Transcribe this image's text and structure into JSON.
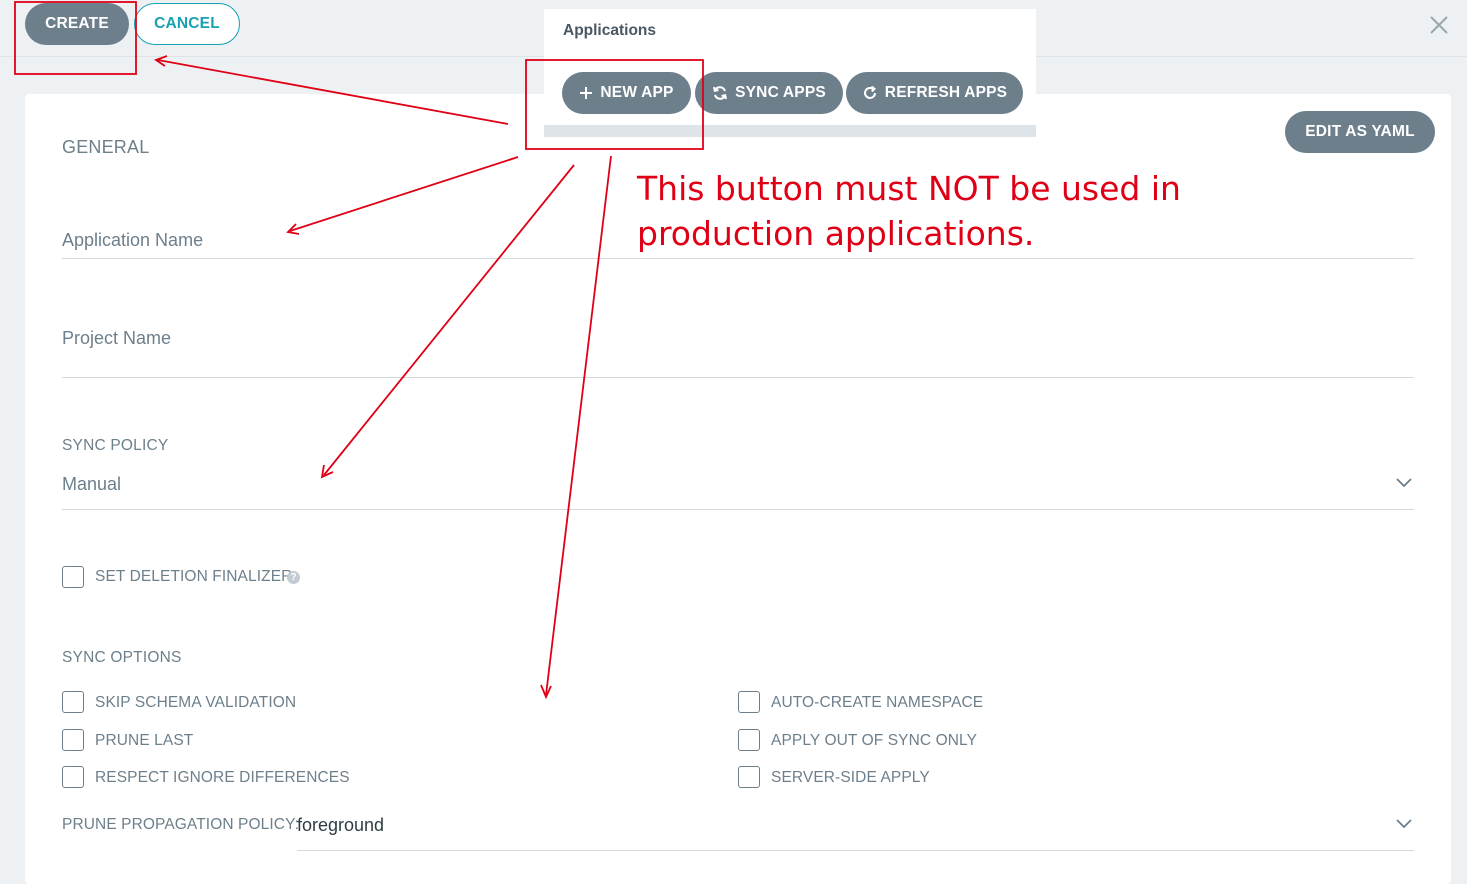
{
  "toolbar": {
    "create_label": "CREATE",
    "cancel_label": "CANCEL"
  },
  "apps_popup": {
    "title": "Applications",
    "new_app_label": "NEW APP",
    "sync_apps_label": "SYNC APPS",
    "refresh_apps_label": "REFRESH APPS"
  },
  "editor": {
    "edit_yaml_label": "EDIT AS YAML"
  },
  "form": {
    "general_heading": "GENERAL",
    "application_name_label": "Application Name",
    "project_name_label": "Project Name",
    "sync_policy_heading": "SYNC POLICY",
    "sync_policy_value": "Manual",
    "deletion_finalizer_label": "SET DELETION FINALIZER",
    "sync_options_heading": "SYNC OPTIONS",
    "sync_options": {
      "skip_schema_validation": "SKIP SCHEMA VALIDATION",
      "prune_last": "PRUNE LAST",
      "respect_ignore_differences": "RESPECT IGNORE DIFFERENCES",
      "auto_create_namespace": "AUTO-CREATE NAMESPACE",
      "apply_out_of_sync_only": "APPLY OUT OF SYNC ONLY",
      "server_side_apply": "SERVER-SIDE APPLY"
    },
    "prune_propagation_label": "PRUNE PROPAGATION POLICY:",
    "prune_propagation_value": "foreground"
  },
  "annotation": {
    "line1": "This button must NOT be used in",
    "line2": "production applications."
  },
  "colors": {
    "button_dark": "#6d7f8b",
    "accent_teal": "#18a1b0",
    "annotation_red": "#e00016"
  }
}
